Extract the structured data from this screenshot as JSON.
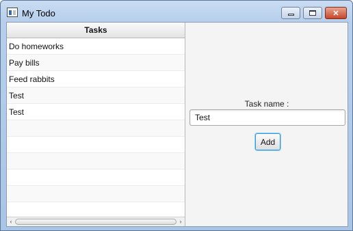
{
  "window": {
    "title": "My Todo",
    "controls": {
      "minimize_icon": "minimize-icon",
      "maximize_icon": "maximize-icon",
      "close_icon": "close-icon",
      "close_glyph": "✕"
    }
  },
  "table": {
    "header": "Tasks",
    "rows": [
      "Do homeworks",
      "Pay bills",
      "Feed rabbits",
      "Test",
      "Test",
      "",
      "",
      "",
      "",
      "",
      ""
    ],
    "scroll_left_glyph": "‹",
    "scroll_right_glyph": "›"
  },
  "form": {
    "label": "Task name :",
    "input_value": "Test",
    "add_label": "Add"
  },
  "colors": {
    "accent_focus": "#2e9bd6",
    "close_button": "#c6462a"
  }
}
